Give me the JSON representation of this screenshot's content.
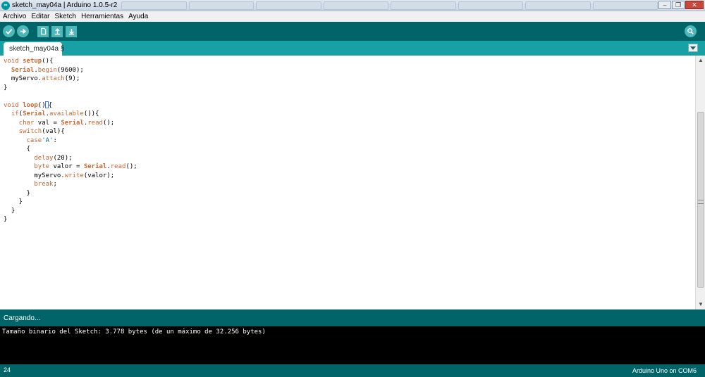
{
  "window": {
    "title": "sketch_may04a | Arduino 1.0.5-r2",
    "icon_text": "∞",
    "controls": [
      "–",
      "❐",
      "✕"
    ]
  },
  "menu": [
    "Archivo",
    "Editar",
    "Sketch",
    "Herramientas",
    "Ayuda"
  ],
  "toolbar": {
    "buttons": [
      "verify-icon",
      "upload-icon",
      "new-icon",
      "open-icon",
      "save-icon"
    ],
    "serial_monitor": "magnifier-icon"
  },
  "tabs": [
    {
      "label": "sketch_may04a §"
    }
  ],
  "editor": {
    "lines": [
      "void setup(){",
      "  Serial.begin(9600);",
      "  myServo.attach(9);",
      "}",
      "",
      "void loop(){",
      "  if(Serial.available()){",
      "    char val = Serial.read();",
      "    switch(val){",
      "      case'A':",
      "      {",
      "        delay(20);",
      "        byte valor = Serial.read();",
      "        myServo.write(valor);",
      "        break;",
      "      }",
      "    }",
      "  }",
      "}"
    ]
  },
  "status": {
    "message": "Cargando..."
  },
  "console": {
    "text": "Tamaño binario del Sketch: 3.778 bytes (de un máximo de 32.256 bytes)"
  },
  "footer": {
    "line_number": "24",
    "board": "Arduino Uno on COM6"
  },
  "colors": {
    "toolbar": "#006468",
    "tabbar": "#17a1a5",
    "keyword": "#cc6633",
    "string": "#006699"
  }
}
